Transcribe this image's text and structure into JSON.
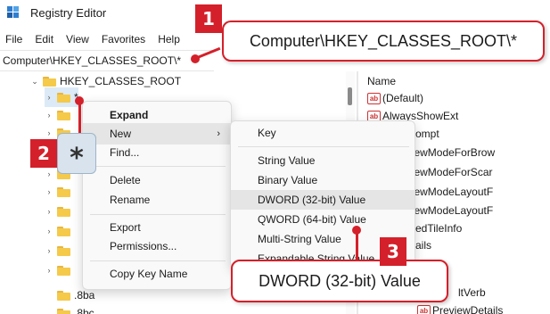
{
  "window": {
    "title": "Registry Editor"
  },
  "menu": [
    "File",
    "Edit",
    "View",
    "Favorites",
    "Help"
  ],
  "address": {
    "path": "Computer\\HKEY_CLASSES_ROOT\\*"
  },
  "tree": {
    "root": "HKEY_CLASSES_ROOT",
    "selected_key": "*",
    "visible_keys": [
      ".8ba",
      ".8bc"
    ]
  },
  "values_pane": {
    "header": "Name",
    "rows": [
      {
        "icon": "string-value-icon",
        "name": "(Default)"
      },
      {
        "icon": "string-value-icon",
        "name": "AlwaysShowExt"
      },
      {
        "icon": "",
        "name": "Prompt"
      },
      {
        "icon": "",
        "name": "ViewModeForBrow"
      },
      {
        "icon": "",
        "name": "ViewModeForScar"
      },
      {
        "icon": "",
        "name": "ViewModeLayoutF"
      },
      {
        "icon": "",
        "name": "ViewModeLayoutF"
      },
      {
        "icon": "",
        "name": "edTileInfo"
      },
      {
        "icon": "",
        "name": "ails"
      },
      {
        "icon": "",
        "name": "ltVerb"
      },
      {
        "icon": "string-value-icon",
        "name": "PreviewDetails"
      }
    ]
  },
  "context_menu": {
    "items": [
      "Expand",
      "New",
      "Find...",
      "Delete",
      "Rename",
      "Export",
      "Permissions...",
      "Copy Key Name"
    ],
    "submenu_arrow": "›"
  },
  "submenu": {
    "items": [
      "Key",
      "String Value",
      "Binary Value",
      "DWORD (32-bit) Value",
      "QWORD (64-bit) Value",
      "Multi-String Value",
      "Expandable String Value"
    ]
  },
  "annotations": {
    "step1": {
      "badge": "1",
      "text": "Computer\\HKEY_CLASSES_ROOT\\*"
    },
    "step2": {
      "badge": "2",
      "text": "*"
    },
    "step3": {
      "badge": "3",
      "text": "DWORD (32-bit) Value"
    }
  },
  "colors": {
    "accent": "#d4202a",
    "folder": "#f5c94a",
    "menu_bg": "#f9f9f9",
    "hover": "#e5e5e5"
  }
}
